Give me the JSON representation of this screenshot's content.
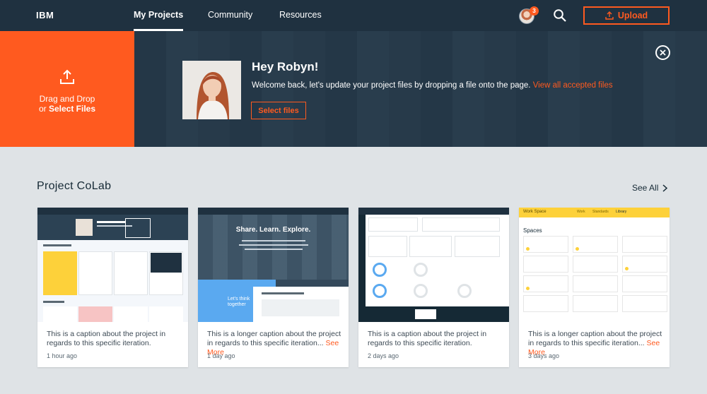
{
  "nav": {
    "brand": "IBM",
    "links": [
      "My Projects",
      "Community",
      "Resources"
    ],
    "notification_count": "3",
    "upload_label": "Upload"
  },
  "hero": {
    "drop_line1": "Drag and Drop",
    "drop_line2_prefix": "or ",
    "drop_line2_bold": "Select Files",
    "greeting": "Hey Robyn!",
    "welcome_text": "Welcome back, let's update your project files by dropping a file onto the page.",
    "welcome_link": "View all accepted files",
    "select_files_label": "Select files"
  },
  "section": {
    "title": "Project CoLab",
    "see_all": "See All"
  },
  "cards": [
    {
      "caption": "This is a caption about the project in regards to this specific iteration.",
      "more": "",
      "time": "1 hour ago"
    },
    {
      "caption": "This is a longer caption about the project in regards to this specific iteration...",
      "more": "See More",
      "time": "1 day ago"
    },
    {
      "caption": "This is a caption about the project in regards to this specific iteration.",
      "more": "",
      "time": "2 days ago"
    },
    {
      "caption": "This is a longer caption about the project in regards to this specific iteration...",
      "more": "See More",
      "time": "3 days ago"
    }
  ],
  "thumbs": {
    "colab": {
      "title": "Share. Learn. Explore.",
      "tag": "Let's think together"
    },
    "workspace": {
      "header": "Work Space",
      "tabs": [
        "Work",
        "Standards",
        "Library"
      ],
      "title": "Spaces"
    }
  },
  "colors": {
    "accent": "#ff5a1f",
    "navy": "#1f3140",
    "page_bg": "#dfe3e6",
    "workspace_yellow": "#fdd13a"
  }
}
